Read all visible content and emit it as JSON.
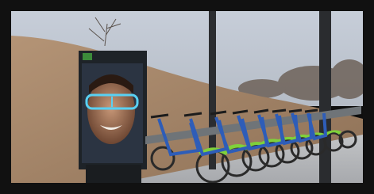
{
  "scene": {
    "kiosk_header": "",
    "kiosk_subheader": "",
    "colors": {
      "sky": "#c4ccd7",
      "grass": "#a8876a",
      "pavement": "#b9bbbf",
      "bike_frame": "#2e5db8",
      "bike_fender": "#7fd13a",
      "kiosk_panel": "#1e2328",
      "frame_border": "#111111"
    }
  }
}
